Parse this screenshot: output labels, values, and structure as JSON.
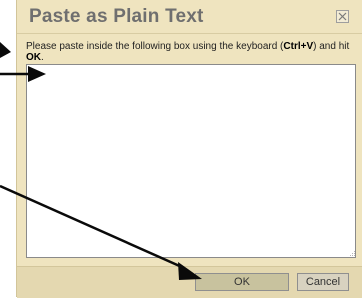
{
  "dialog": {
    "title": "Paste as Plain Text",
    "close_symbol": "close-icon",
    "instructions": {
      "part1": "Please paste inside the following box using the keyboard (",
      "shortcut": "Ctrl+V",
      "part2": ") and hit ",
      "ok_word": "OK",
      "part3": "."
    },
    "paste_area": {
      "value": ""
    },
    "buttons": {
      "ok": "OK",
      "cancel": "Cancel"
    }
  },
  "colors": {
    "dialog_bg": "#efe4bf",
    "footer_bg": "#e4d8b0",
    "title_text": "#6f6f6f",
    "arrow": "#0a0a0a"
  }
}
